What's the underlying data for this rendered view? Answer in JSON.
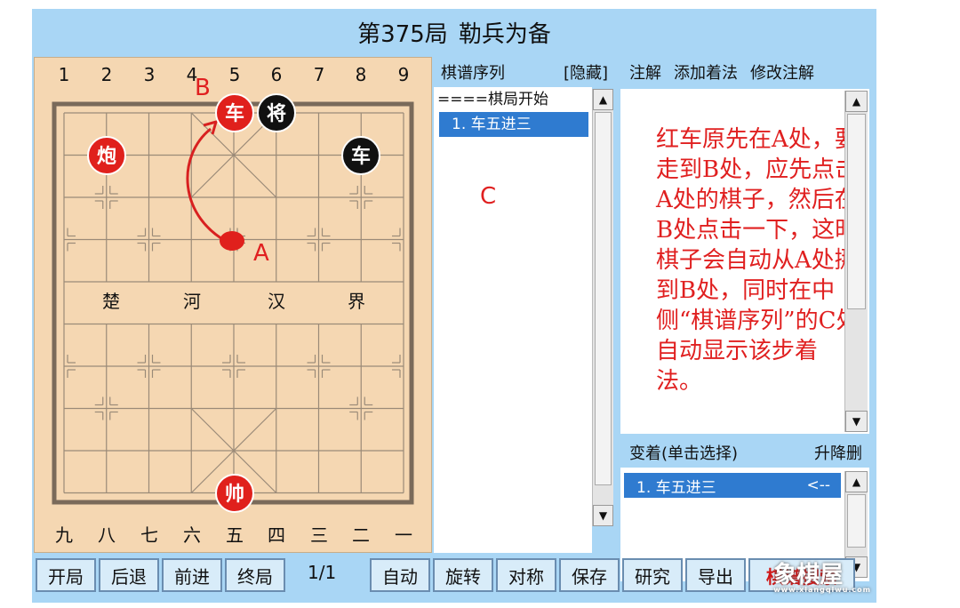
{
  "title": {
    "number": "第375局",
    "name": "勒兵为备"
  },
  "board": {
    "top_numbers": [
      "1",
      "2",
      "3",
      "4",
      "5",
      "6",
      "7",
      "8",
      "9"
    ],
    "bottom_numbers": [
      "九",
      "八",
      "七",
      "六",
      "五",
      "四",
      "三",
      "二",
      "一"
    ],
    "river": [
      "楚",
      "河",
      "汉",
      "界"
    ],
    "pieces": [
      {
        "label": "车",
        "side": "red"
      },
      {
        "label": "将",
        "side": "black"
      },
      {
        "label": "炮",
        "side": "red"
      },
      {
        "label": "车",
        "side": "black"
      },
      {
        "label": "帅",
        "side": "red"
      }
    ],
    "annotations": {
      "a": "A",
      "b": "B"
    }
  },
  "moves": {
    "title": "棋谱序列",
    "hide": "[隐藏]",
    "items": [
      "====棋局开始",
      "1. 车五进三"
    ],
    "marker": "C"
  },
  "notes": {
    "tabs": [
      "注解",
      "添加着法",
      "修改注解"
    ],
    "text": "红车原先在A处，要走到B处，应先点击A处的棋子，然后在B处点击一下，这时棋子会自动从A处挪到B处，同时在中侧“棋谱序列”的C处自动显示该步着法。"
  },
  "variations": {
    "title": "变着(单击选择)",
    "action": "升降删",
    "items": [
      {
        "move": "1. 车五进三",
        "arrow": "<--"
      }
    ]
  },
  "toolbar": {
    "buttons": [
      "开局",
      "后退",
      "前进",
      "终局",
      "自动",
      "旋转",
      "对称",
      "保存",
      "研究",
      "导出",
      "棋谱搜索"
    ],
    "page": "1/1"
  },
  "watermark": {
    "main": "象棋屋",
    "sub": "www.xiangqiwu.com"
  },
  "colors": {
    "red_piece": "#e0201c",
    "black_piece": "#111111",
    "annotation": "#e02020",
    "selection": "#2f7bd0"
  }
}
